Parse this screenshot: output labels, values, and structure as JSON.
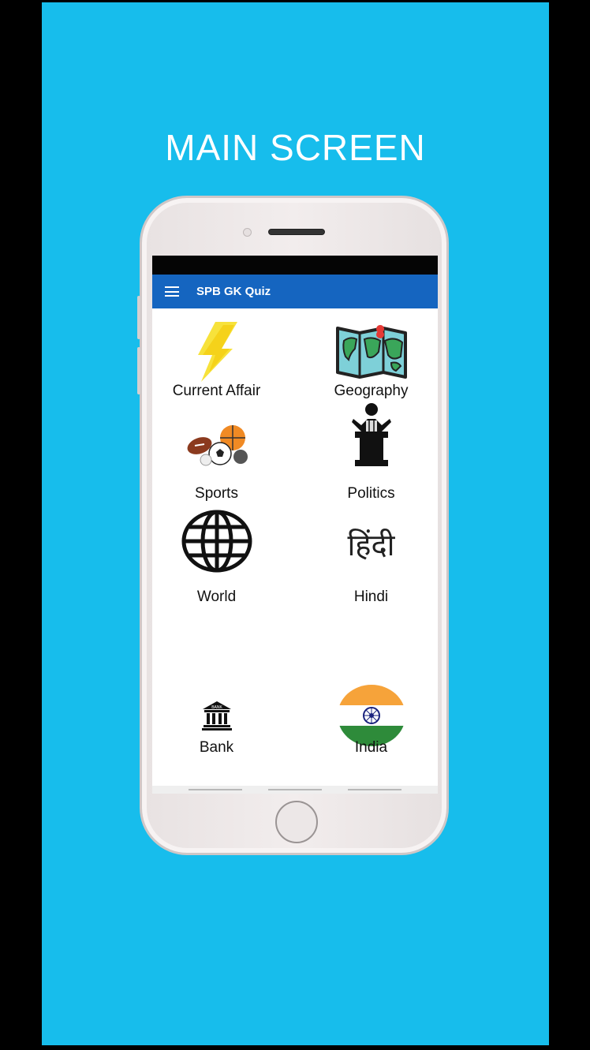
{
  "headline": "MAIN SCREEN",
  "app": {
    "title": "SPB GK Quiz",
    "menu_icon": "hamburger-menu-icon",
    "appbar_color": "#1565c0"
  },
  "background_color": "#17bdec",
  "categories": [
    {
      "label": "Current Affair",
      "icon": "lightning-bolt-icon"
    },
    {
      "label": "Geography",
      "icon": "world-map-icon"
    },
    {
      "label": "Sports",
      "icon": "sports-balls-icon"
    },
    {
      "label": "Politics",
      "icon": "politician-podium-icon"
    },
    {
      "label": "World",
      "icon": "globe-icon"
    },
    {
      "label": "Hindi",
      "icon": "hindi-text-icon",
      "icon_text": "हिंदी"
    },
    {
      "label": "Bank",
      "icon": "bank-building-icon",
      "icon_text": "BANK"
    },
    {
      "label": "India",
      "icon": "india-flag-icon"
    }
  ]
}
